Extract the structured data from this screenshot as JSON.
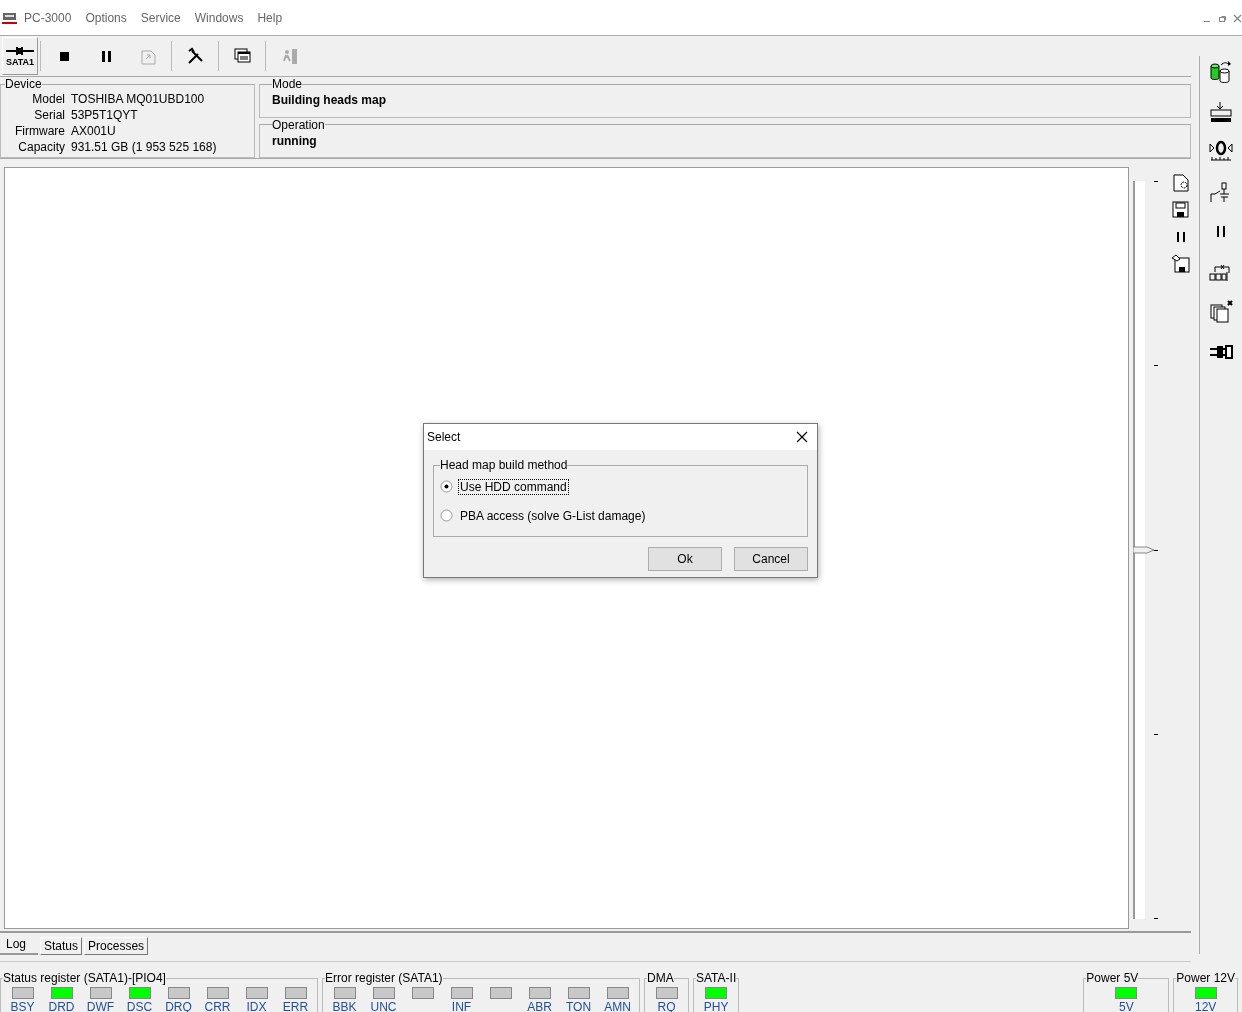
{
  "menu": {
    "title": "PC-3000",
    "items": [
      "Options",
      "Service",
      "Windows",
      "Help"
    ]
  },
  "toolbar": [
    {
      "label": "SATA1",
      "disabled": false
    },
    {
      "disabled": false
    },
    {
      "disabled": false
    },
    {
      "disabled": true
    },
    {
      "disabled": false
    },
    {
      "disabled": false
    },
    {
      "disabled": true
    }
  ],
  "device": {
    "title": "Device",
    "fields": [
      {
        "label": "Model",
        "value": "TOSHIBA MQ01UBD100"
      },
      {
        "label": "Serial",
        "value": "53P5T1QYT"
      },
      {
        "label": "Firmware",
        "value": "AX001U"
      },
      {
        "label": "Capacity",
        "value": "931.51 GB (1 953 525 168)"
      }
    ]
  },
  "mode": {
    "title": "Mode",
    "value": "Building heads map"
  },
  "operation": {
    "title": "Operation",
    "value": "running"
  },
  "log_slider": {
    "level": 0.5
  },
  "tabs": [
    {
      "label": "Log",
      "selected": true
    },
    {
      "label": "Status",
      "selected": false
    },
    {
      "label": "Processes",
      "selected": false
    }
  ],
  "registers": [
    {
      "title": "Status register (SATA1)-[PIO4]",
      "lights": [
        {
          "label": "BSY",
          "on": false
        },
        {
          "label": "DRD",
          "on": true
        },
        {
          "label": "DWF",
          "on": false
        },
        {
          "label": "DSC",
          "on": true
        },
        {
          "label": "DRQ",
          "on": false
        },
        {
          "label": "CRR",
          "on": false
        },
        {
          "label": "IDX",
          "on": false
        },
        {
          "label": "ERR",
          "on": false
        }
      ]
    },
    {
      "title": "Error register (SATA1)",
      "lights": [
        {
          "label": "BBK",
          "on": false
        },
        {
          "label": "UNC",
          "on": false
        },
        {
          "on": false
        },
        {
          "label": "INF",
          "on": false
        },
        {
          "on": false
        },
        {
          "label": "ABR",
          "on": false
        },
        {
          "label": "TON",
          "on": false
        },
        {
          "label": "AMN",
          "on": false
        }
      ]
    },
    {
      "title": "DMA",
      "lights": [
        {
          "label": "RQ",
          "on": false
        }
      ]
    },
    {
      "title": "SATA-II",
      "lights": [
        {
          "label": "PHY",
          "on": true
        }
      ]
    },
    {
      "title": "Power 5V",
      "lights": [
        {
          "label": "5V",
          "on": true
        }
      ]
    },
    {
      "title": "Power 12V",
      "lights": [
        {
          "label": "12V",
          "on": true
        }
      ]
    }
  ],
  "dialog": {
    "title": "Select",
    "group": "Head map build method",
    "options": [
      {
        "label": "Use HDD command",
        "selected": true
      },
      {
        "label": "PBA access (solve G-List damage)",
        "selected": false
      }
    ],
    "buttons": [
      "Ok",
      "Cancel"
    ]
  }
}
